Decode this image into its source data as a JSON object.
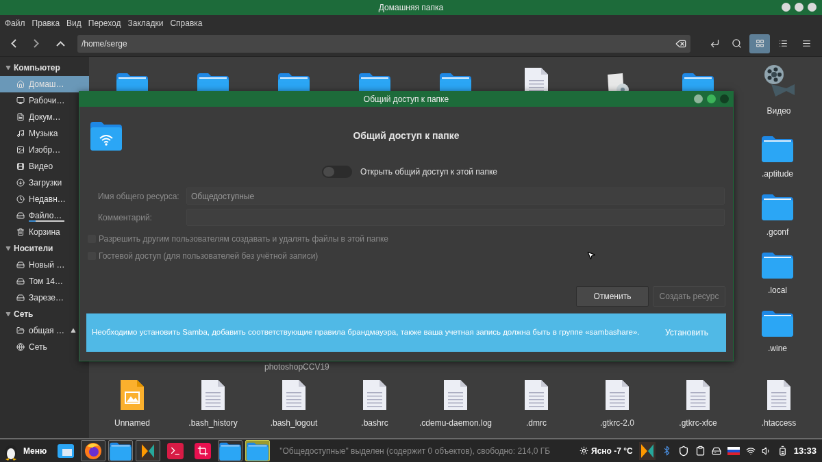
{
  "window": {
    "title": "Домашняя папка"
  },
  "menu": [
    "Файл",
    "Правка",
    "Вид",
    "Переход",
    "Закладки",
    "Справка"
  ],
  "toolbar": {
    "path": "/home/serge",
    "view_buttons": [
      {
        "kind": "grid",
        "selected": true
      },
      {
        "kind": "compact",
        "selected": false
      },
      {
        "kind": "list",
        "selected": false
      }
    ]
  },
  "sidebar": [
    {
      "title": "Компьютер",
      "expanded": true,
      "items": [
        {
          "label": "Домаш…",
          "kind": "home",
          "selected": true
        },
        {
          "label": "Рабочи…",
          "kind": "desktop",
          "selected": false
        },
        {
          "label": "Докум…",
          "kind": "document",
          "selected": false
        },
        {
          "label": "Музыка",
          "kind": "music",
          "selected": false
        },
        {
          "label": "Изобр…",
          "kind": "image",
          "selected": false
        },
        {
          "label": "Видео",
          "kind": "video",
          "selected": false
        },
        {
          "label": "Загрузки",
          "kind": "download",
          "selected": false
        },
        {
          "label": "Недавн…",
          "kind": "recent",
          "selected": false
        },
        {
          "label": "Файло…",
          "kind": "drive",
          "selected": false,
          "level": 0.2
        },
        {
          "label": "Корзина",
          "kind": "trash",
          "selected": false
        }
      ]
    },
    {
      "title": "Носители",
      "expanded": true,
      "items": [
        {
          "label": "Новый …",
          "kind": "drive",
          "selected": false
        },
        {
          "label": "Том 14…",
          "kind": "drive",
          "selected": false
        },
        {
          "label": "Зарезе…",
          "kind": "drive",
          "selected": false
        }
      ]
    },
    {
      "title": "Сеть",
      "expanded": true,
      "items": [
        {
          "label": "общая …",
          "kind": "share",
          "selected": false,
          "eject": true
        },
        {
          "label": "Сеть",
          "kind": "network",
          "selected": false
        }
      ]
    }
  ],
  "content": {
    "top_row": [
      {
        "kind": "folder"
      },
      {
        "kind": "folder"
      },
      {
        "kind": "folder"
      },
      {
        "kind": "folder"
      },
      {
        "kind": "folder-shared"
      },
      {
        "kind": "text"
      },
      {
        "kind": "package"
      },
      {
        "kind": "folder"
      },
      {
        "kind": "video",
        "name": "Видео"
      }
    ],
    "right_column": [
      {
        "kind": "folder",
        "name": ".aptitude"
      },
      {
        "kind": "folder",
        "name": ".gconf"
      },
      {
        "kind": "folder",
        "name": ".local"
      },
      {
        "kind": "folder",
        "name": ".wine"
      }
    ],
    "partial_label": "photoshopCCV19",
    "bottom_row": [
      {
        "kind": "image",
        "name": "Unnamed"
      },
      {
        "kind": "text",
        "name": ".bash_history"
      },
      {
        "kind": "text",
        "name": ".bash_logout"
      },
      {
        "kind": "text",
        "name": ".bashrc"
      },
      {
        "kind": "text",
        "name": ".cdemu-daemon.log"
      },
      {
        "kind": "text",
        "name": ".dmrc"
      },
      {
        "kind": "text",
        "name": ".gtkrc-2.0"
      },
      {
        "kind": "text",
        "name": ".gtkrc-xfce"
      },
      {
        "kind": "text",
        "name": ".htaccess"
      }
    ]
  },
  "dialog": {
    "title": "Общий доступ к папке",
    "heading": "Общий доступ к папке",
    "toggle": {
      "label": "Открыть общий доступ к этой папке",
      "on": false
    },
    "fields": [
      {
        "label": "Имя общего ресурса:",
        "value": "Общедоступные",
        "disabled": true
      },
      {
        "label": "Комментарий:",
        "disabled": true
      }
    ],
    "checkboxes": [
      {
        "label": "Разрешить другим пользователям создавать и удалять файлы в этой папке",
        "checked": false,
        "disabled": true
      },
      {
        "label": "Гостевой доступ (для пользователей без учётной записи)",
        "checked": false,
        "disabled": true
      }
    ],
    "buttons": [
      {
        "label": "Отменить",
        "disabled": false
      },
      {
        "label": "Создать ресурс",
        "disabled": true
      }
    ],
    "info": {
      "text": "Необходимо установить Samba, добавить соответствующие правила брандмауэра, также ваша учетная запись должна быть в группе «sambashare».",
      "action": "Установить"
    }
  },
  "taskbar": {
    "menu": "Меню",
    "apps": [
      {
        "kind": "files",
        "open": false,
        "selected": false
      },
      {
        "kind": "firefox",
        "open": true,
        "selected": false
      },
      {
        "kind": "folder",
        "open": true,
        "selected": false
      },
      {
        "kind": "k",
        "open": true,
        "selected": false
      },
      {
        "kind": "terminal",
        "open": false,
        "selected": false
      },
      {
        "kind": "crop",
        "open": false,
        "selected": false
      },
      {
        "kind": "folder",
        "open": true,
        "selected": false
      },
      {
        "kind": "folder",
        "open": true,
        "selected": true
      }
    ],
    "status": "\"Общедоступные\" выделен (содержит 0 объектов), свободно: 214,0 ГБ",
    "weather": "Ясно -7 °C",
    "clock": "13:33"
  }
}
